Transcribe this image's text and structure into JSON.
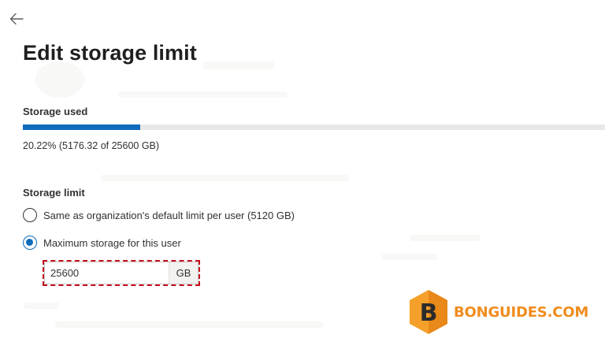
{
  "header": {
    "title": "Edit storage limit"
  },
  "storage_used": {
    "heading": "Storage used",
    "percent": 20.22,
    "summary": "20.22% (5176.32 of 25600 GB)"
  },
  "storage_limit": {
    "heading": "Storage limit",
    "options": [
      {
        "label": "Same as organization's default limit per user (5120 GB)",
        "selected": false
      },
      {
        "label": "Maximum storage for this user",
        "selected": true
      }
    ],
    "input_value": "25600",
    "unit": "GB"
  },
  "watermark": {
    "badge_letter": "B",
    "text": "BONGUIDES.COM",
    "color": "#f08c1e"
  },
  "colors": {
    "accent": "#0f6cbd",
    "highlight": "#c50f1f"
  },
  "icons": {
    "back": "back-arrow-icon",
    "logo": "bonguides-logo-icon"
  }
}
